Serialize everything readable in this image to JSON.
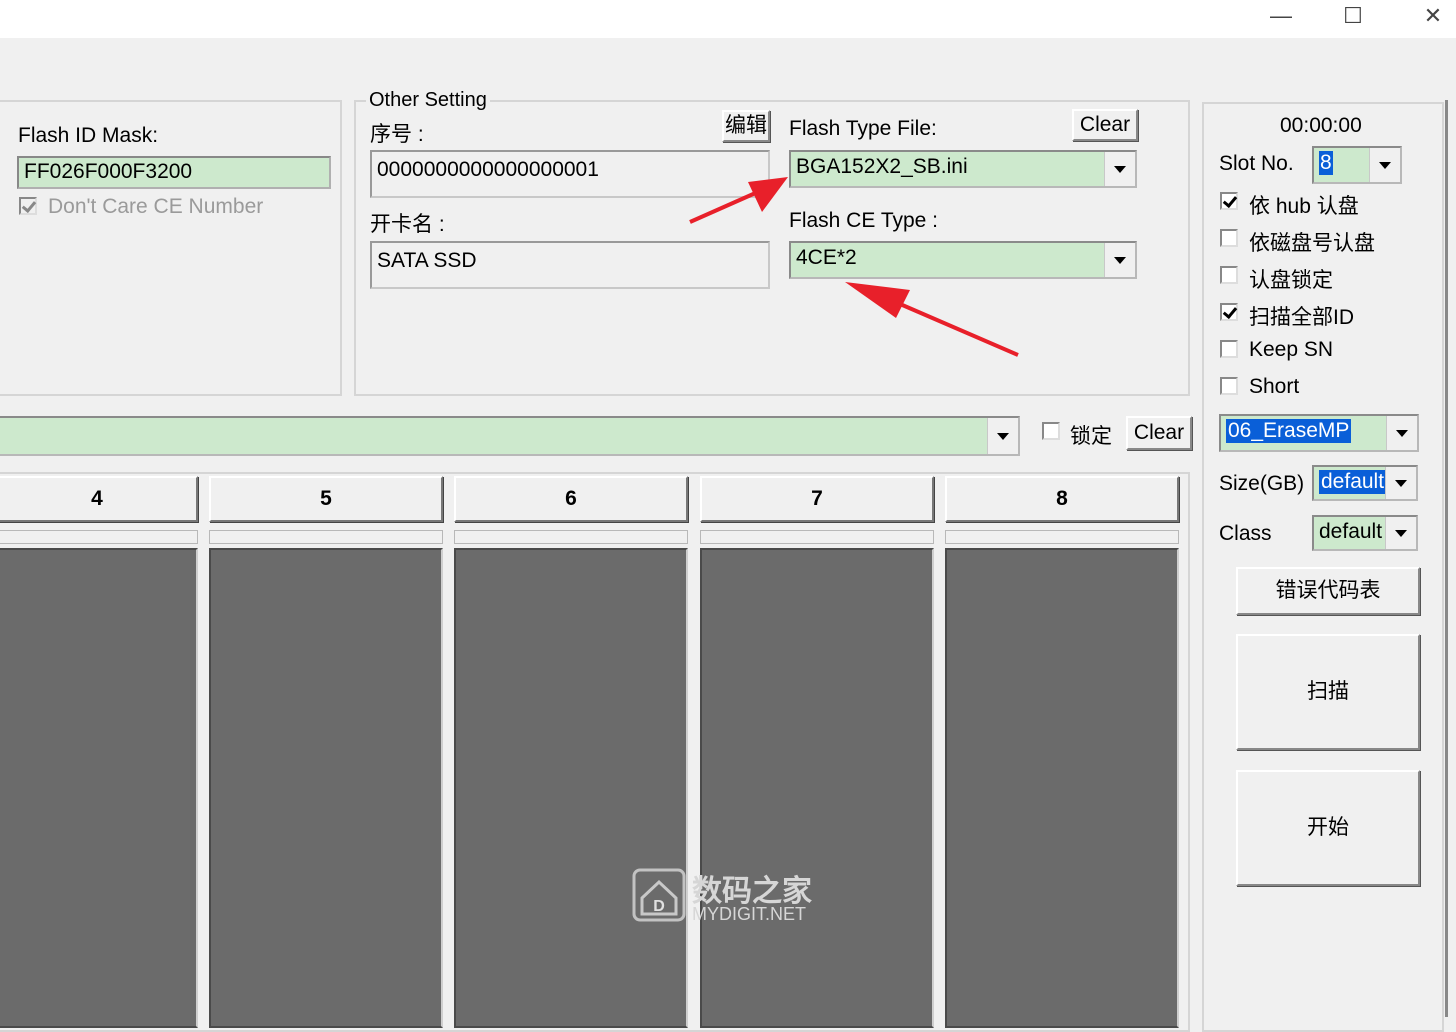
{
  "window": {
    "controls": {
      "minimize": "—",
      "maximize": "☐",
      "close": "✕"
    }
  },
  "flash_id": {
    "mask_label": "Flash ID Mask:",
    "mask_value": "FF026F000F3200",
    "dont_care_label": "Don't Care CE Number",
    "dont_care_checked": true
  },
  "other_setting": {
    "title": "Other Setting",
    "serial_label": "序号 :",
    "edit_button": "编辑",
    "serial_value": "0000000000000000001",
    "card_name_label": "开卡名 :",
    "card_name_value": "SATA SSD",
    "flash_type_label": "Flash Type File:",
    "flash_type_clear": "Clear",
    "flash_type_value": "BGA152X2_SB.ini",
    "flash_ce_label": "Flash CE Type :",
    "flash_ce_value": "4CE*2"
  },
  "toolbar_row": {
    "combo_value": "",
    "lock_label": "锁定",
    "lock_checked": false,
    "clear_button": "Clear"
  },
  "slots": [
    {
      "label": "4"
    },
    {
      "label": "5"
    },
    {
      "label": "6"
    },
    {
      "label": "7"
    },
    {
      "label": "8"
    }
  ],
  "right_panel": {
    "timer": "00:00:00",
    "slot_no_label": "Slot No.",
    "slot_no_value": "8",
    "options": [
      {
        "label": "依 hub 认盘",
        "checked": true
      },
      {
        "label": "依磁盘号认盘",
        "checked": false
      },
      {
        "label": "认盘锁定",
        "checked": false
      },
      {
        "label": "扫描全部ID",
        "checked": true
      },
      {
        "label": "Keep SN",
        "checked": false
      },
      {
        "label": "Short",
        "checked": false
      }
    ],
    "mode_value": "06_EraseMP",
    "size_label": "Size(GB)",
    "size_value": "default",
    "class_label": "Class",
    "class_value": "default",
    "error_code_button": "错误代码表",
    "scan_button": "扫描",
    "start_button": "开始"
  },
  "watermark": {
    "brand_cn": "数码之家",
    "brand_en": "MYDIGIT.NET"
  },
  "colors": {
    "field_green": "#cde9cd",
    "slot_body": "#6b6b6b",
    "selection": "#0a5fd8",
    "arrow": "#e8202a"
  }
}
